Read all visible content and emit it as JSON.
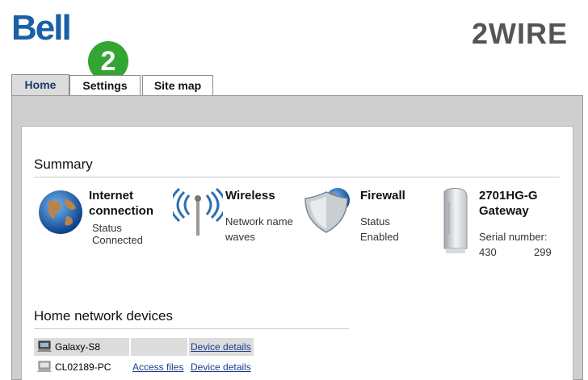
{
  "header": {
    "left_logo": "Bell",
    "right_logo": "2WIRE"
  },
  "step_badge": "2",
  "tabs": [
    {
      "label": "Home",
      "active": true
    },
    {
      "label": "Settings",
      "active": false
    },
    {
      "label": "Site map",
      "active": false
    }
  ],
  "summary": {
    "title": "Summary",
    "internet": {
      "title_line1": "Internet",
      "title_line2": "connection",
      "status_label": "Status",
      "status_value": "Connected",
      "icon": "globe-icon"
    },
    "wireless": {
      "title": "Wireless",
      "network_label": "Network name",
      "network_value": "waves",
      "icon": "wireless-antenna-icon"
    },
    "firewall": {
      "title": "Firewall",
      "status_label": "Status",
      "status_value": "Enabled",
      "icon": "shield-globe-icon"
    },
    "gateway": {
      "title_line1": "2701HG-G",
      "title_line2": "Gateway",
      "serial_label": "Serial number:",
      "serial_part1": "430",
      "serial_part2": "299",
      "icon": "gateway-device-icon"
    }
  },
  "devices": {
    "title": "Home network devices",
    "rows": [
      {
        "name": "Galaxy-S8",
        "access": "",
        "details": "Device details",
        "icon": "computer-icon"
      },
      {
        "name": "CL02189-PC",
        "access": "Access files",
        "details": "Device details",
        "icon": "computer-icon"
      }
    ]
  },
  "colors": {
    "brand_blue": "#1a5fa8",
    "badge_green": "#33a532",
    "frame_gray": "#cfcfcf"
  }
}
